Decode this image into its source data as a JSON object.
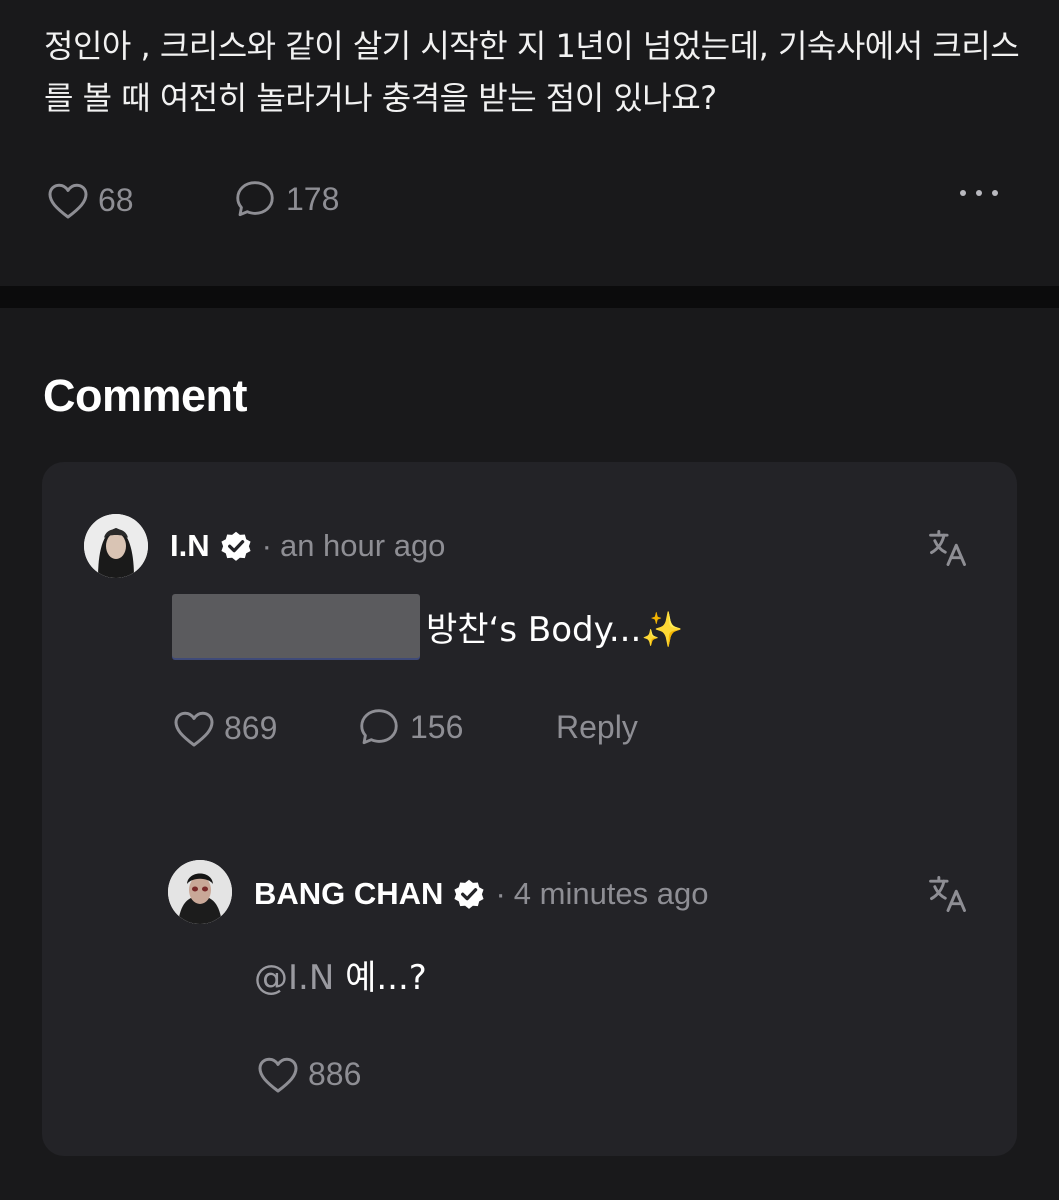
{
  "post": {
    "text": "정인아 , 크리스와 같이 살기 시작한 지 1년이 넘었는데, 기숙사에서 크리스를 볼 때 여전히 놀라거나 충격을 받는 점이 있나요?",
    "likes": "68",
    "comments": "178"
  },
  "comments_section": {
    "title": "Comment",
    "comment": {
      "author": "I.N",
      "time": "an hour ago",
      "text": "방찬‘s Body...✨",
      "likes": "869",
      "replies": "156",
      "reply_label": "Reply"
    },
    "reply": {
      "author": "BANG CHAN",
      "time": "4 minutes ago",
      "mention": "@I.N",
      "text": " 예...?",
      "likes": "886"
    }
  },
  "colors": {
    "background": "#19191b",
    "card": "#232327",
    "muted_text": "#8e8e94"
  }
}
